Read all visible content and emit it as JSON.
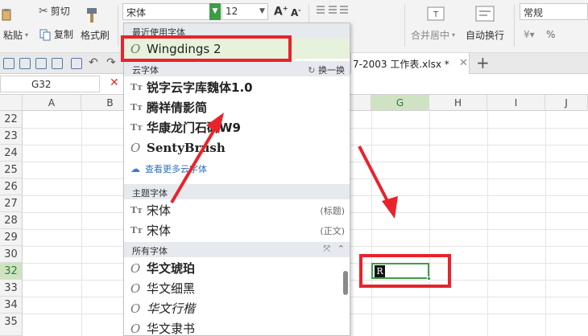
{
  "ribbon": {
    "cut_label": "剪切",
    "copy_label": "复制",
    "paste_label": "粘贴",
    "format_painter_label": "格式刷",
    "font_name": "宋体",
    "font_size": "12",
    "merge_center_label": "合并居中",
    "wrap_text_label": "自动换行",
    "number_format": "常规",
    "percent_symbol": "%"
  },
  "tabs": {
    "document_tab_label": "7-2003 工作表.xlsx *"
  },
  "formula_bar": {
    "name_box": "G32"
  },
  "columns": [
    "A",
    "B",
    "G",
    "H",
    "I",
    "J"
  ],
  "rows": [
    "22",
    "23",
    "24",
    "25",
    "26",
    "27",
    "28",
    "29",
    "30",
    "31",
    "32",
    "33",
    "34",
    "35"
  ],
  "cell_g32_value": "R",
  "dropdown": {
    "recent_header": "最近使用字体",
    "recent_font": "Wingdings 2",
    "cloud_header": "云字体",
    "cloud_switch": "换一换",
    "cloud_fonts": [
      "锐字云字库魏体1.0",
      "腾祥倩影简",
      "华康龙门石碑W9",
      "SentyBrush"
    ],
    "more_cloud": "查看更多云字体",
    "theme_header": "主题字体",
    "theme_fonts": [
      {
        "name": "宋体",
        "tag": "(标题)"
      },
      {
        "name": "宋体",
        "tag": "(正文)"
      }
    ],
    "all_header": "所有字体",
    "all_fonts": [
      "华文琥珀",
      "华文细黑",
      "华文行楷",
      "华文隶书"
    ]
  },
  "colors": {
    "accent_green": "#3f9c46",
    "highlight_red": "#e8232b",
    "recent_bg": "#e6f2dc"
  }
}
